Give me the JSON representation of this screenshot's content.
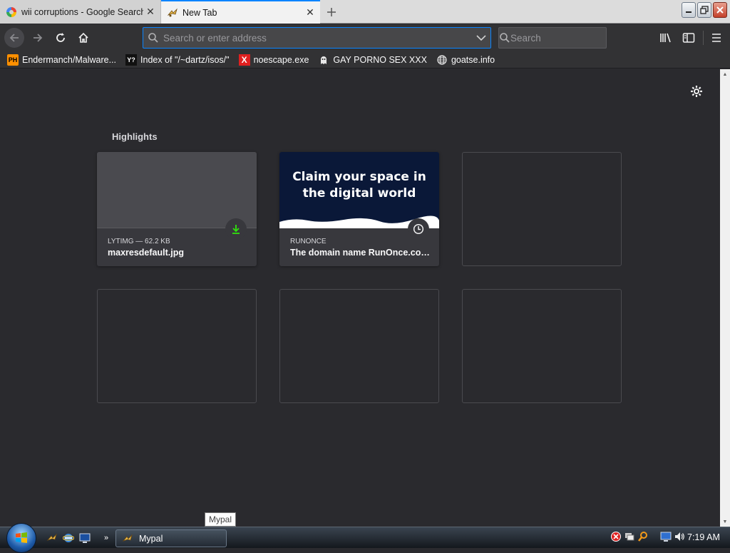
{
  "browser": {
    "tabs": [
      {
        "label": "wii corruptions - Google Search",
        "icon": "google-icon",
        "active": false
      },
      {
        "label": "New Tab",
        "icon": "mypal-icon",
        "active": true
      }
    ],
    "urlbar": {
      "placeholder": "Search or enter address",
      "value": ""
    },
    "searchbar": {
      "placeholder": "Search",
      "value": ""
    },
    "bookmarks": [
      {
        "label": "Endermanch/Malware...",
        "icon": "ph-icon"
      },
      {
        "label": "Index of \"/~dartz/isos/\"",
        "icon": "yp-icon"
      },
      {
        "label": "noescape.exe",
        "icon": "x-icon"
      },
      {
        "label": "GAY PORNO SEX XXX",
        "icon": "ghost-icon"
      },
      {
        "label": "goatse.info",
        "icon": "globe-icon"
      }
    ]
  },
  "newtab": {
    "highlights_title": "Highlights",
    "cards": [
      {
        "meta": "LYTIMG — 62.2 KB",
        "title": "maxresdefault.jpg",
        "badge": "download-icon"
      },
      {
        "meta": "RUNONCE",
        "title": "The domain name RunOnce.com...",
        "promo_text": "Claim your space in the digital world",
        "badge": "clock-icon"
      }
    ]
  },
  "taskbar": {
    "task_label": "Mypal",
    "tooltip": "Mypal",
    "clock": "7:19 AM"
  },
  "colors": {
    "accent": "#0a84ff",
    "content_bg": "#2a2a2e",
    "toolbar_bg": "#323234",
    "download_green": "#30e60b"
  }
}
